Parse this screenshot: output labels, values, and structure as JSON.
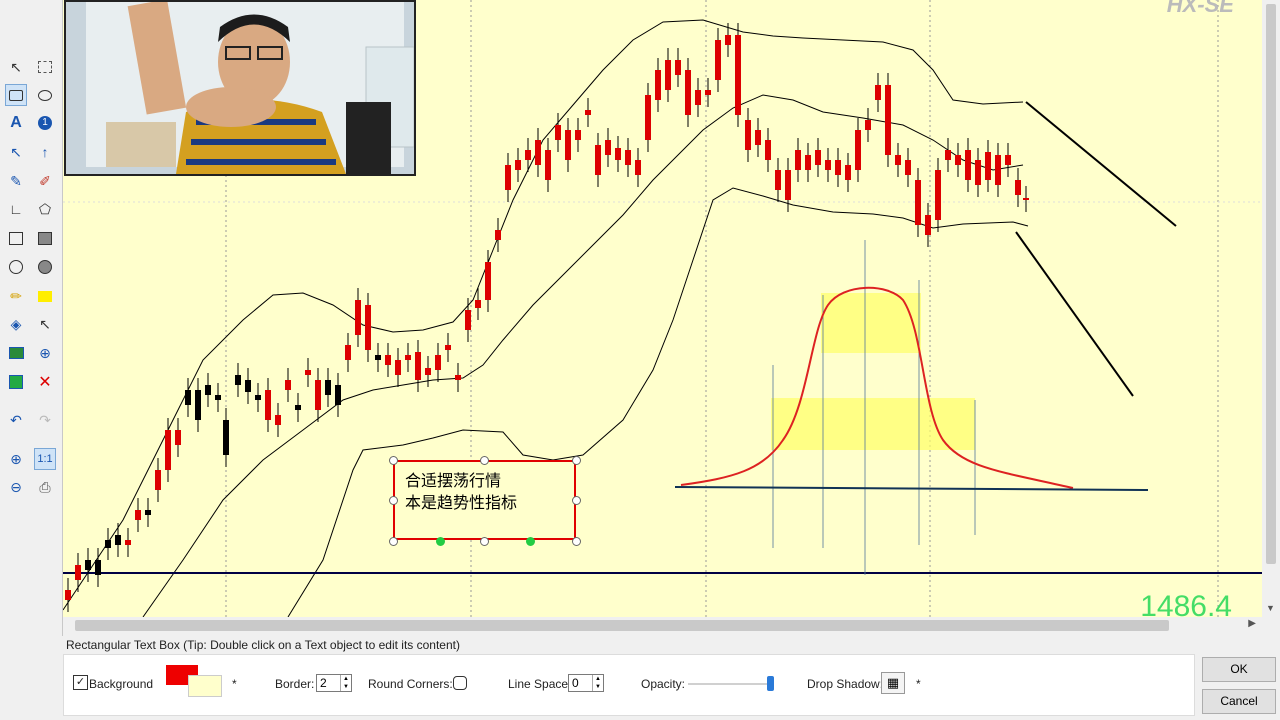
{
  "chart": {
    "logo_text": "HX-SE",
    "price_label": "1486.4"
  },
  "textbox": {
    "line1": "合适摆荡行情",
    "line2": "本是趋势性指标"
  },
  "status": {
    "text": "Rectangular Text Box (Tip: Double click on a Text object to edit its content)"
  },
  "props": {
    "background_label": "Background",
    "background_checked": true,
    "border_color": "#ee0000",
    "fill_color": "#ffffcc",
    "asterisk": "*",
    "border_label": "Border:",
    "border_value": "2",
    "round_corners_label": "Round Corners:",
    "line_space_label": "Line Space:",
    "line_space_value": "0",
    "opacity_label": "Opacity:",
    "opacity_value": 1.0,
    "drop_shadow_label": "Drop Shadow:"
  },
  "buttons": {
    "ok": "OK",
    "cancel": "Cancel"
  },
  "toolbar_icons": [
    "pointer-icon",
    "select-rect-icon",
    "callout-rect-icon",
    "callout-oval-icon",
    "text-icon",
    "numbered-label-icon",
    "arrow-icon",
    "thick-arrow-icon",
    "pen-icon",
    "eraser-icon",
    "angle-icon",
    "polygon-icon",
    "rect-icon",
    "filled-rect-icon",
    "circle-icon",
    "filled-circle-icon",
    "highlighter-icon",
    "yellow-fill-icon",
    "paint-bucket-icon",
    "pointer-plus-icon",
    "image-icon",
    "crosshair-icon",
    "green-square-icon",
    "delete-icon",
    "undo-icon",
    "redo-icon",
    "zoom-in-icon",
    "one-to-one-label",
    "zoom-out-icon",
    "print-icon"
  ],
  "toolbar_labels": {
    "one_to_one": "1:1"
  }
}
